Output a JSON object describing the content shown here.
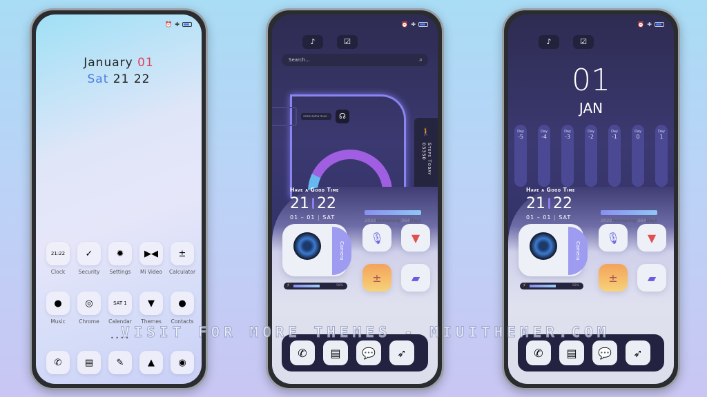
{
  "phone1": {
    "status": {
      "alarm": "alarm-icon",
      "bluetooth": "bluetooth-icon"
    },
    "month": "January",
    "day": "01",
    "weekday": "Sat",
    "time": "21 22",
    "apps": [
      {
        "label": "Clock",
        "glyph": "21:22"
      },
      {
        "label": "Security",
        "glyph": "✓"
      },
      {
        "label": "Settings",
        "glyph": "✹"
      },
      {
        "label": "Mi Video",
        "glyph": "▶◀"
      },
      {
        "label": "Calculator",
        "glyph": "±"
      },
      {
        "label": "Music",
        "glyph": "●"
      },
      {
        "label": "Chrome",
        "glyph": "◎"
      },
      {
        "label": "Calendar",
        "glyph": "SAT 1"
      },
      {
        "label": "Themes",
        "glyph": "▼"
      },
      {
        "label": "Contacts",
        "glyph": "●"
      }
    ],
    "page_dots": "• • • •",
    "dock": [
      {
        "name": "phone",
        "glyph": "✆"
      },
      {
        "name": "messages",
        "glyph": "▤"
      },
      {
        "name": "notes",
        "glyph": "✎"
      },
      {
        "name": "gallery",
        "glyph": "▲"
      },
      {
        "name": "camera",
        "glyph": "◉"
      }
    ]
  },
  "phone2": {
    "tabs": [
      "music-tab-icon",
      "calendar-tab-icon"
    ],
    "search_placeholder": "Search...",
    "music_text": "some some musi...",
    "steps_label": "Steps Today",
    "steps": "03350",
    "greeting": "Have a Good Time",
    "hour": "21",
    "minute": "22",
    "date": "01 – 01",
    "weekday": "SAT",
    "year_progress": {
      "year": "2022",
      "remaining_label": "Remaining",
      "days": "364",
      "days_label": "Days"
    },
    "camera_label": "Camera",
    "battery_pct": "58%"
  },
  "phone3": {
    "day_num": "01",
    "month": "JAN",
    "days": [
      {
        "label": "Day",
        "value": "-5"
      },
      {
        "label": "Day",
        "value": "-4"
      },
      {
        "label": "Day",
        "value": "-3"
      },
      {
        "label": "Day",
        "value": "-2"
      },
      {
        "label": "Day",
        "value": "-1"
      },
      {
        "label": "Day",
        "value": "0"
      },
      {
        "label": "Day",
        "value": "1"
      }
    ],
    "greeting": "Have a Good Time",
    "hour": "21",
    "minute": "22",
    "date": "01 – 01",
    "weekday": "SAT",
    "year_progress": {
      "year": "2022",
      "remaining_label": "Remaining",
      "days": "364",
      "days_label": "Days"
    },
    "camera_label": "Camera",
    "battery_pct": "58%"
  },
  "dark_dock": [
    {
      "name": "phone",
      "glyph": "✆"
    },
    {
      "name": "messages",
      "glyph": "▤"
    },
    {
      "name": "wechat",
      "glyph": "💬"
    },
    {
      "name": "browser",
      "glyph": "➶"
    }
  ],
  "watermark": "VISIT FOR MORE THEMES - MIUITHEMER.COM",
  "colors": {
    "accent_red": "#e0405a",
    "accent_blue": "#4a7be0",
    "dark_bg": "#34336a"
  }
}
